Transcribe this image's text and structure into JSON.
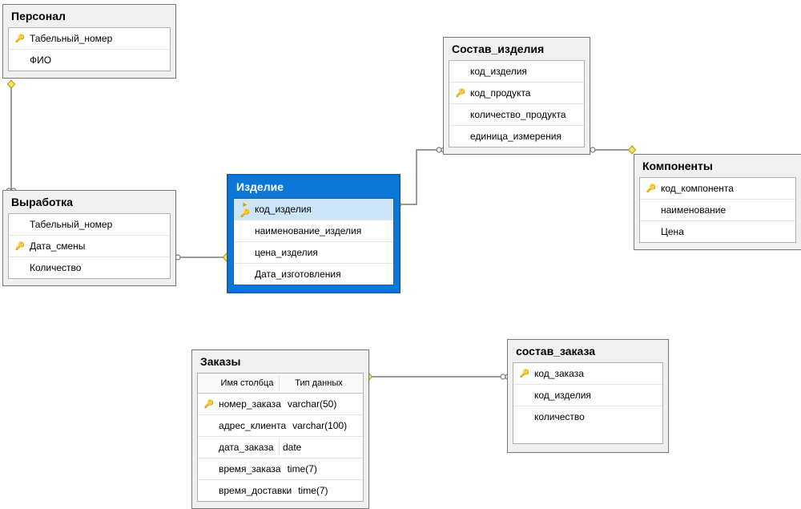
{
  "entities": {
    "personnel": {
      "title": "Персонал",
      "columns": [
        {
          "name": "Табельный_номер",
          "pk": true
        },
        {
          "name": "ФИО",
          "pk": false
        }
      ]
    },
    "output": {
      "title": "Выработка",
      "columns": [
        {
          "name": "Табельный_номер",
          "pk": false
        },
        {
          "name": "Дата_смены",
          "pk": true
        },
        {
          "name": "Количество",
          "pk": false
        }
      ]
    },
    "product": {
      "title": "Изделие",
      "columns": [
        {
          "name": "код_изделия",
          "pk": true,
          "selected": true
        },
        {
          "name": "наименование_изделия",
          "pk": false
        },
        {
          "name": "цена_изделия",
          "pk": false
        },
        {
          "name": "Дата_изготовления",
          "pk": false
        }
      ]
    },
    "product_composition": {
      "title": "Состав_изделия",
      "columns": [
        {
          "name": "код_изделия",
          "pk": false
        },
        {
          "name": "код_продукта",
          "pk": true
        },
        {
          "name": "количество_продукта",
          "pk": false
        },
        {
          "name": "единица_измерения",
          "pk": false
        }
      ]
    },
    "components": {
      "title": "Компоненты",
      "columns": [
        {
          "name": "код_компонента",
          "pk": true
        },
        {
          "name": "наименование",
          "pk": false
        },
        {
          "name": "Цена",
          "pk": false
        }
      ]
    },
    "orders": {
      "title": "Заказы",
      "header_cols": {
        "name_label": "Имя столбца",
        "type_label": "Тип данных"
      },
      "columns": [
        {
          "name": "номер_заказа",
          "type": "varchar(50)",
          "pk": true
        },
        {
          "name": "адрес_клиента",
          "type": "varchar(100)",
          "pk": false
        },
        {
          "name": "дата_заказа",
          "type": "date",
          "pk": false
        },
        {
          "name": "время_заказа",
          "type": "time(7)",
          "pk": false
        },
        {
          "name": "время_доставки",
          "type": "time(7)",
          "pk": false
        }
      ]
    },
    "order_composition": {
      "title": "состав_заказа",
      "columns": [
        {
          "name": "код_заказа",
          "pk": true
        },
        {
          "name": "код_изделия",
          "pk": false
        },
        {
          "name": "количество",
          "pk": false
        }
      ]
    }
  }
}
